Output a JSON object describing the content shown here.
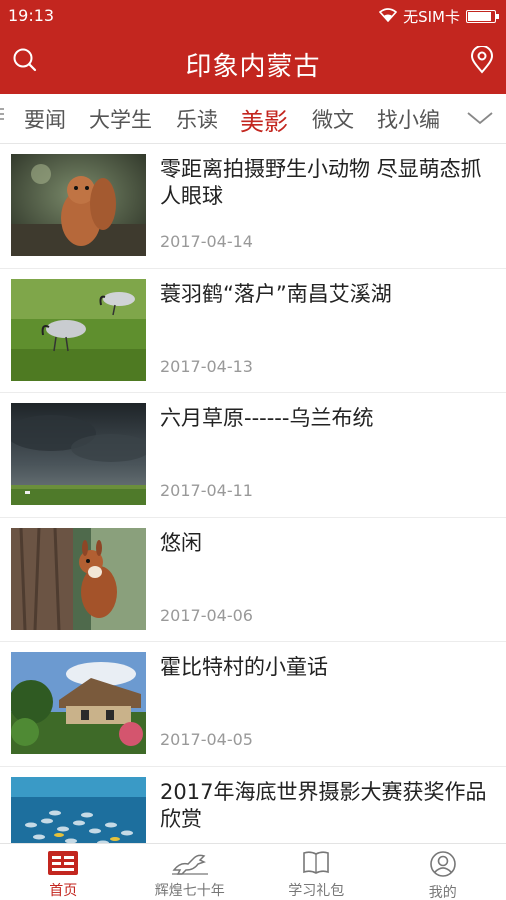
{
  "status_bar": {
    "time": "19:13",
    "carrier": "无SIM卡",
    "battery_level": 0.9
  },
  "app_bar": {
    "title": "印象内蒙古",
    "left_icon": "search-icon",
    "right_icon": "location-pin-icon",
    "background": "#c3261f"
  },
  "tabs": {
    "items": [
      {
        "label": "要闻",
        "active": false
      },
      {
        "label": "大学生",
        "active": false
      },
      {
        "label": "乐读",
        "active": false
      },
      {
        "label": "美影",
        "active": true
      },
      {
        "label": "微文",
        "active": false
      },
      {
        "label": "找小编",
        "active": false
      }
    ],
    "more_icon": "chevron-down-icon",
    "active_color": "#c3261f"
  },
  "news": [
    {
      "title": "零距离拍摄野生小动物 尽显萌态抓人眼球",
      "date": "2017-04-14"
    },
    {
      "title": "蓑羽鹤“落户”南昌艾溪湖",
      "date": "2017-04-13"
    },
    {
      "title": "六月草原------乌兰布统",
      "date": "2017-04-11"
    },
    {
      "title": "悠闲",
      "date": "2017-04-06"
    },
    {
      "title": "霍比特村的小童话",
      "date": "2017-04-05"
    },
    {
      "title": "2017年海底世界摄影大赛获奖作品欣赏",
      "date": ""
    }
  ],
  "bottom_nav": [
    {
      "label": "首页",
      "icon": "home-newspaper-icon",
      "active": true
    },
    {
      "label": "辉煌七十年",
      "icon": "horse-icon",
      "active": false
    },
    {
      "label": "学习礼包",
      "icon": "book-icon",
      "active": false
    },
    {
      "label": "我的",
      "icon": "user-icon",
      "active": false
    }
  ]
}
